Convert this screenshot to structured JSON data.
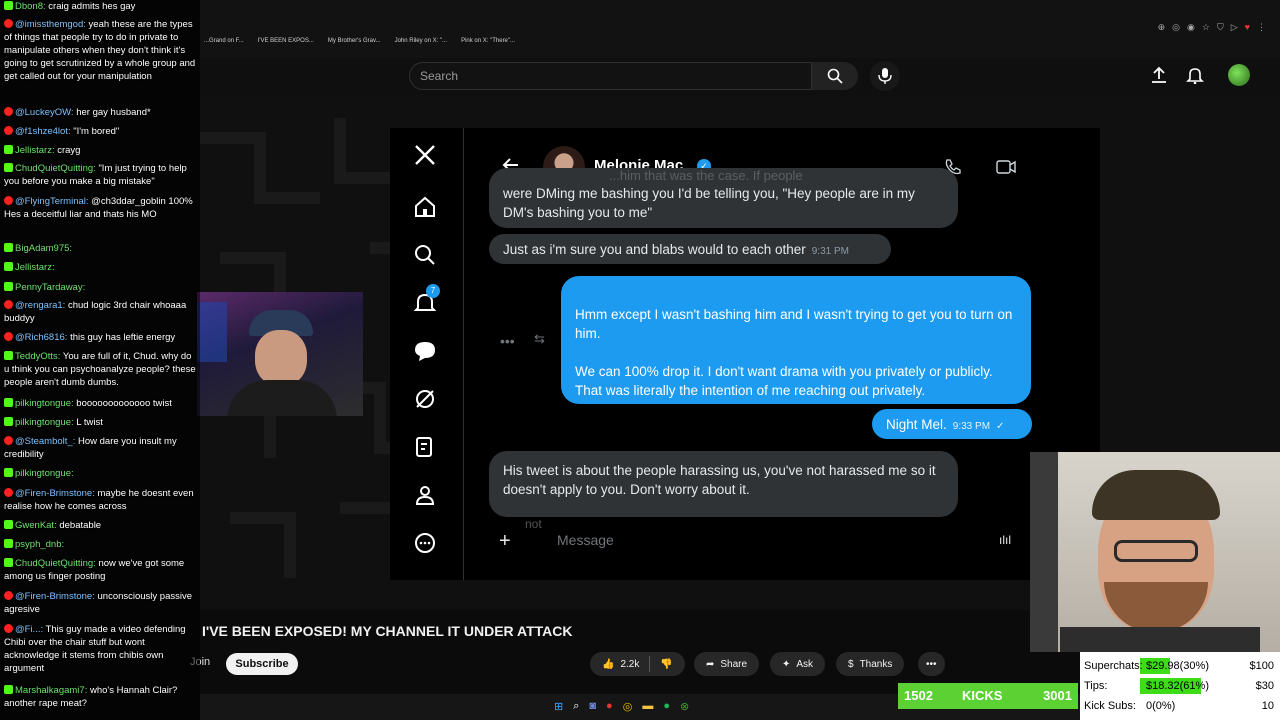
{
  "bookmarks": [
    "...Grand on F...",
    "I'VE BEEN EXPOS...",
    "My Brother's Grav...",
    "John Riley on X: \"...",
    "Pink on X: \"There\"..."
  ],
  "header": {
    "search_placeholder": "Search"
  },
  "x_app": {
    "notification_count": "7",
    "contact_name": "Melonie Mac",
    "messages": [
      {
        "dir": "in",
        "hidden_text": "...him that was the case. If people",
        "text": "were DMing me bashing you I'd be telling you, \"Hey people are in my DM's bashing you to me\""
      },
      {
        "dir": "in",
        "text": "Just as i'm sure you and blabs would to each other",
        "time": "9:31 PM"
      },
      {
        "dir": "out",
        "text": "Hmm except I wasn't bashing him and I wasn't trying to get you to turn on him.\n\nWe can 100% drop it. I don't want drama with you privately or publicly. That was literally the intention of me reaching out privately."
      },
      {
        "dir": "out",
        "text": "Night Mel.",
        "time": "9:33 PM"
      },
      {
        "dir": "in",
        "text": "His tweet is about the people harassing us, you've not harassed me so it doesn't apply to you. Don't worry about it."
      }
    ],
    "typing_ghost": "not",
    "composer_placeholder": "Message"
  },
  "video": {
    "title": "I'VE BEEN EXPOSED! MY CHANNEL IT UNDER ATTACK",
    "join_label": "Join",
    "subscribe_label": "Subscribe",
    "likes": "2.2k",
    "share_label": "Share",
    "ask_label": "Ask",
    "thanks_label": "Thanks"
  },
  "chat": [
    {
      "platform": "kick",
      "user": "Dbon8",
      "text": "craig admits hes gay"
    },
    {
      "platform": "yt",
      "user": "@imissthemgod",
      "text": "yeah these are the types of things that people try to do in private to manipulate others when they don't think it's going to get scrutinized by a whole group and get called out for your manipulation"
    },
    {
      "platform": "yt",
      "user": "@LuckeyOW",
      "text": "her gay husband*"
    },
    {
      "platform": "yt",
      "user": "@f1shze4lot",
      "text": "\"I'm bored\""
    },
    {
      "platform": "kick",
      "user": "Jellistarz",
      "text": "crayg"
    },
    {
      "platform": "kick",
      "user": "ChudQuietQuitting",
      "text": "\"Im just trying to help you before you make a big mistake\""
    },
    {
      "platform": "yt",
      "user": "@FlyingTerminal",
      "text": "@ch3ddar_goblin 100% Hes a deceitful liar and thats his MO"
    },
    {
      "platform": "kick",
      "user": "BigAdam975",
      "text": ""
    },
    {
      "platform": "kick",
      "user": "Jellistarz",
      "text": ""
    },
    {
      "platform": "kick",
      "user": "PennyTardaway",
      "text": ""
    },
    {
      "platform": "yt",
      "user": "@rengara1",
      "text": "chud logic 3rd chair whoaaa buddyy"
    },
    {
      "platform": "yt",
      "user": "@Rich6816",
      "text": "this guy has leftie energy"
    },
    {
      "platform": "kick",
      "user": "TeddyOtts",
      "text": "You are full of it, Chud. why do u think you can psychoanalyze people? these people aren't dumb dumbs."
    },
    {
      "platform": "kick",
      "user": "pilkingtongue",
      "text": "booooooooooooo twist"
    },
    {
      "platform": "kick",
      "user": "pilkingtongue",
      "text": "L twist"
    },
    {
      "platform": "yt",
      "user": "@Steambolt_",
      "text": "How dare you insult my credibility"
    },
    {
      "platform": "kick",
      "user": "pilkingtongue",
      "text": ""
    },
    {
      "platform": "yt",
      "user": "@Firen-Brimstone",
      "text": "maybe he doesnt even realise how he comes across"
    },
    {
      "platform": "kick",
      "user": "GwenKat",
      "text": "debatable"
    },
    {
      "platform": "kick",
      "user": "psyph_dnb",
      "text": ""
    },
    {
      "platform": "kick",
      "user": "ChudQuietQuitting",
      "text": "now we've got some among us finger posting"
    },
    {
      "platform": "yt",
      "user": "@Firen-Brimstone",
      "text": "unconsciously passive agresive"
    },
    {
      "platform": "yt",
      "user": "@Fi...",
      "text": "This guy made a video defending Chibi over the chair stuff but wont acknowledge it stems from chibis own argument"
    },
    {
      "platform": "kick",
      "user": "Marshalkagami7",
      "text": "who's Hannah Clair? another rape meat?"
    }
  ],
  "kick_bar": {
    "left": "1502",
    "label": "KICKS",
    "right": "3001"
  },
  "donations": [
    {
      "label": "Superchats:",
      "value": "$29.98(30%)",
      "goal": "$100",
      "pct": 30
    },
    {
      "label": "Tips:",
      "value": "$18.32(61%)",
      "goal": "$30",
      "pct": 61
    },
    {
      "label": "Kick Subs:",
      "value": "0(0%)",
      "goal": "10",
      "pct": 0
    }
  ]
}
